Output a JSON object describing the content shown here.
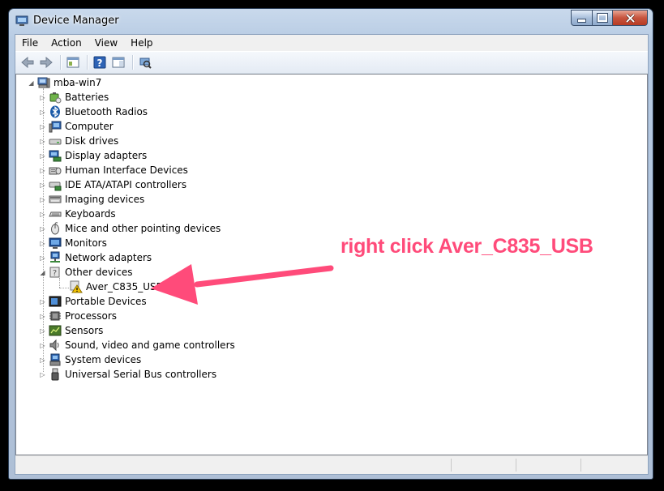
{
  "window": {
    "title": "Device Manager"
  },
  "menu": {
    "file": "File",
    "action": "Action",
    "view": "View",
    "help": "Help"
  },
  "toolbar": {
    "icons": [
      "back-icon",
      "forward-icon",
      "show-hide-console-tree-icon",
      "help-icon",
      "properties-pane-icon",
      "scan-hardware-icon"
    ]
  },
  "tree": {
    "root": "mba-win7",
    "categories": [
      {
        "label": "Batteries",
        "icon": "battery-icon"
      },
      {
        "label": "Bluetooth Radios",
        "icon": "bluetooth-icon"
      },
      {
        "label": "Computer",
        "icon": "computer-icon"
      },
      {
        "label": "Disk drives",
        "icon": "disk-drive-icon"
      },
      {
        "label": "Display adapters",
        "icon": "display-adapter-icon"
      },
      {
        "label": "Human Interface Devices",
        "icon": "hid-icon"
      },
      {
        "label": "IDE ATA/ATAPI controllers",
        "icon": "ide-controller-icon"
      },
      {
        "label": "Imaging devices",
        "icon": "imaging-device-icon"
      },
      {
        "label": "Keyboards",
        "icon": "keyboard-icon"
      },
      {
        "label": "Mice and other pointing devices",
        "icon": "mouse-icon"
      },
      {
        "label": "Monitors",
        "icon": "monitor-icon"
      },
      {
        "label": "Network adapters",
        "icon": "network-adapter-icon"
      },
      {
        "label": "Other devices",
        "icon": "unknown-device-icon"
      },
      {
        "label": "Portable Devices",
        "icon": "portable-device-icon"
      },
      {
        "label": "Processors",
        "icon": "processor-icon"
      },
      {
        "label": "Sensors",
        "icon": "sensor-icon"
      },
      {
        "label": "Sound, video and game controllers",
        "icon": "sound-icon"
      },
      {
        "label": "System devices",
        "icon": "system-device-icon"
      },
      {
        "label": "Universal Serial Bus controllers",
        "icon": "usb-icon"
      }
    ],
    "other_devices_child": "Aver_C835_USB"
  },
  "annotation": {
    "text": "right click Aver_C835_USB",
    "color": "#ff4b7a"
  }
}
